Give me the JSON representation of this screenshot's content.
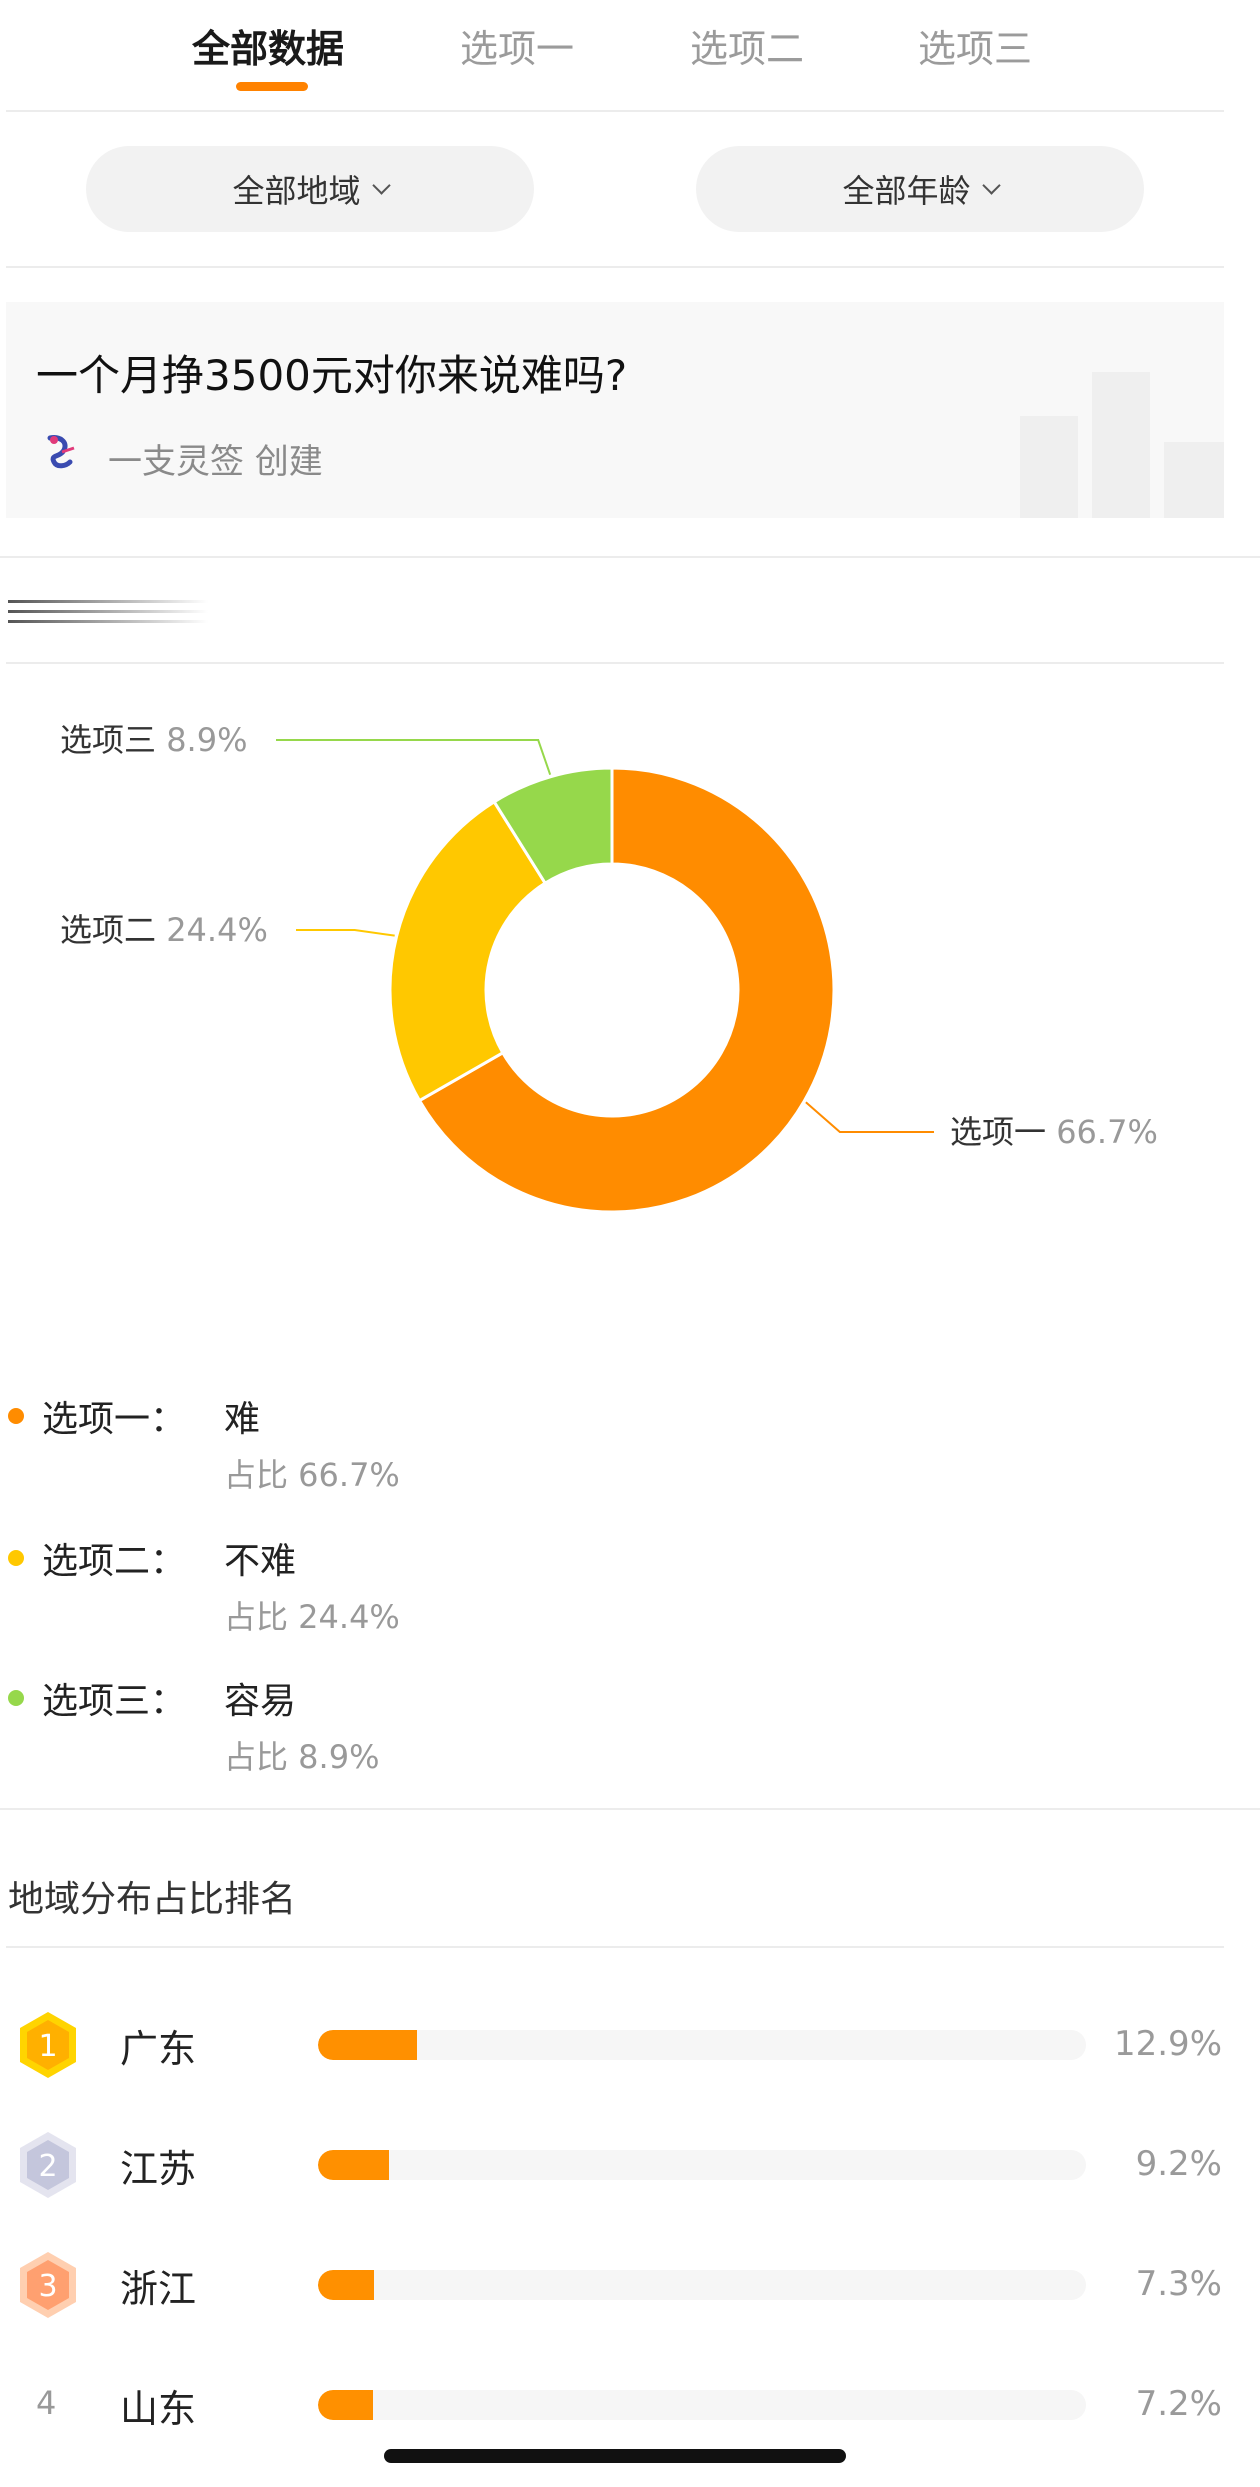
{
  "tabs": [
    {
      "label": "全部数据",
      "active": true
    },
    {
      "label": "选项一",
      "active": false
    },
    {
      "label": "选项二",
      "active": false
    },
    {
      "label": "选项三",
      "active": false
    }
  ],
  "filters": {
    "region": "全部地域",
    "age": "全部年龄"
  },
  "question": {
    "title": "一个月挣3500元对你来说难吗?",
    "creator": "一支灵签 创建"
  },
  "chart_data": {
    "type": "pie",
    "donut": true,
    "slices": [
      {
        "label": "选项一",
        "value": 66.7,
        "pct_text": "66.7%",
        "color": "#ff8c00"
      },
      {
        "label": "选项二",
        "value": 24.4,
        "pct_text": "24.4%",
        "color": "#ffc800"
      },
      {
        "label": "选项三",
        "value": 8.9,
        "pct_text": "8.9%",
        "color": "#96d84b"
      }
    ]
  },
  "legend": [
    {
      "label": "选项一：",
      "answer": "难",
      "share": "占比 66.7%",
      "color": "#ff8c00"
    },
    {
      "label": "选项二：",
      "answer": "不难",
      "share": "占比 24.4%",
      "color": "#ffc800"
    },
    {
      "label": "选项三：",
      "answer": "容易",
      "share": "占比 8.9%",
      "color": "#96d84b"
    }
  ],
  "ranking": {
    "title": "地域分布占比排名",
    "items": [
      {
        "rank": "1",
        "province": "广东",
        "value": 12.9,
        "pct": "12.9%",
        "badge": "gold"
      },
      {
        "rank": "2",
        "province": "江苏",
        "value": 9.2,
        "pct": "9.2%",
        "badge": "silver"
      },
      {
        "rank": "3",
        "province": "浙江",
        "value": 7.3,
        "pct": "7.3%",
        "badge": "bronze"
      },
      {
        "rank": "4",
        "province": "山东",
        "value": 7.2,
        "pct": "7.2%",
        "badge": "none"
      }
    ]
  },
  "colors": {
    "accent": "#ff8200",
    "bar": "#ff9000"
  }
}
